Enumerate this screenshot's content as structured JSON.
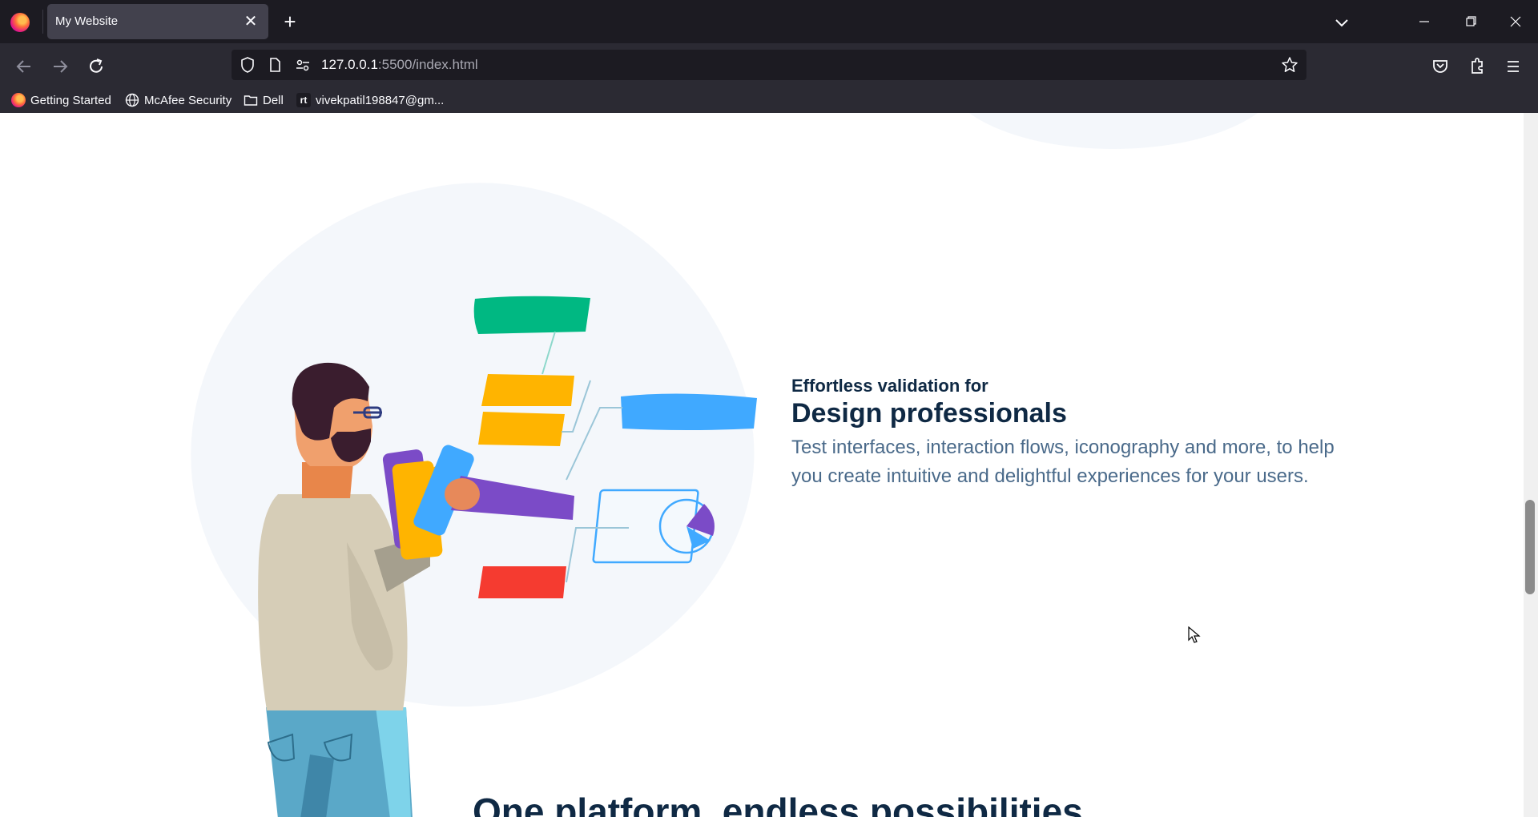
{
  "browser": {
    "tab_title": "My Website",
    "url_host": "127.0.0.1",
    "url_rest": ":5500/index.html",
    "bookmarks": [
      {
        "label": "Getting Started",
        "icon": "firefox-icon"
      },
      {
        "label": "McAfee Security",
        "icon": "globe-icon"
      },
      {
        "label": "Dell",
        "icon": "folder-icon"
      },
      {
        "label": "vivekpatil198847@gm...",
        "icon": "site-icon"
      }
    ]
  },
  "feature": {
    "eyebrow": "Effortless validation for",
    "headline": "Design professionals",
    "body": "Test interfaces, interaction flows, iconography and more, to help you create intuitive and delightful experiences for your users."
  },
  "next_section": {
    "title": "One platform, endless possibilities"
  },
  "colors": {
    "navy": "#0f2944",
    "body_text": "#4a6a8a",
    "green": "#00b882",
    "blue": "#40a9ff",
    "yellow": "#ffb400",
    "purple": "#7b4bc7",
    "red": "#f53b30"
  }
}
